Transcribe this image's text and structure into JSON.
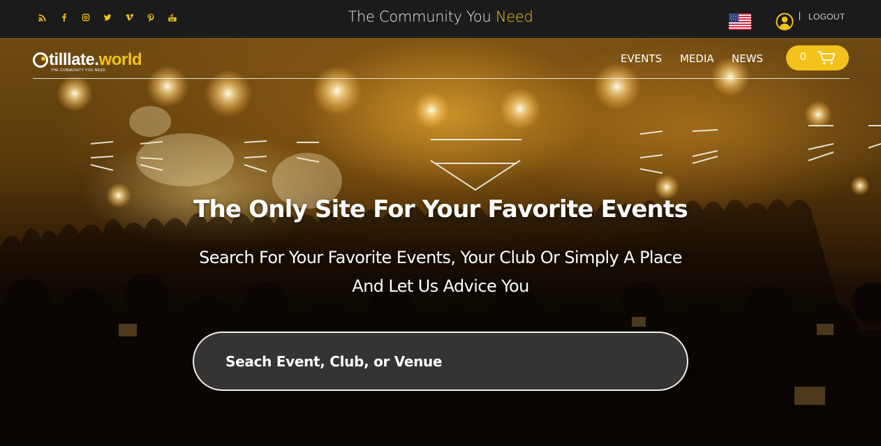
{
  "topbar": {
    "social_icons": [
      "rss-icon",
      "facebook-icon",
      "instagram-icon",
      "twitter-icon",
      "vimeo-icon",
      "pinterest-icon",
      "youtube-icon"
    ],
    "tagline_main": "The Community You ",
    "tagline_accent": "Need",
    "flag": "us-flag-icon",
    "user": "user-icon",
    "logout_label": "LOGOUT"
  },
  "nav": {
    "logo_text": "tilllate.",
    "logo_text_accent": "world",
    "logo_tagline": "THE COMMUNITY YOU NEED",
    "items": [
      {
        "label": "EVENTS"
      },
      {
        "label": "MEDIA"
      },
      {
        "label": "NEWS"
      }
    ],
    "cart_count": "0",
    "cart_icon": "cart-icon"
  },
  "hero": {
    "title": "The Only Site For Your Favorite Events",
    "subtitle": "Search For Your Favorite Events, Your Club Or Simply A Place And Let Us Advice You",
    "search_placeholder": "Seach Event, Club, or Venue"
  },
  "colors": {
    "accent": "#f2c21b",
    "topbar_bg": "#1b1b1b",
    "text": "#ffffff"
  }
}
